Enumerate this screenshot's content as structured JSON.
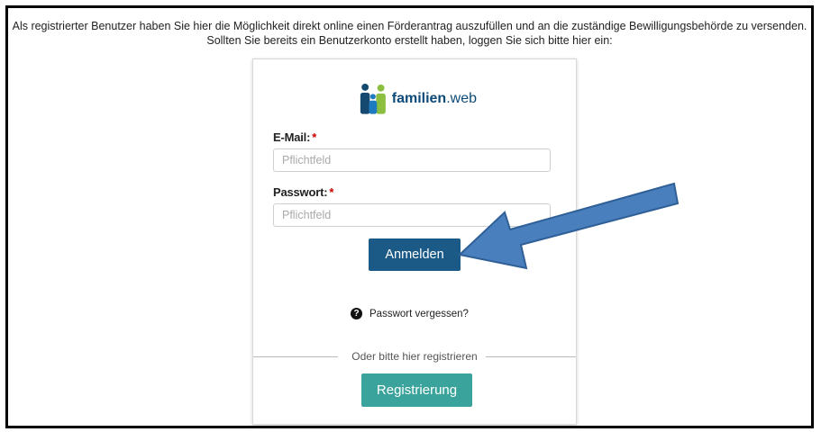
{
  "intro": {
    "line1": "Als registrierter Benutzer haben Sie hier die Möglichkeit direkt online einen Förderantrag auszufüllen und an die zuständige Bewilligungsbehörde zu versenden.",
    "line2": "Sollten Sie bereits ein Benutzerkonto erstellt haben, loggen Sie sich bitte hier ein:"
  },
  "logo": {
    "brand_bold": "familien",
    "brand_suffix": ".web"
  },
  "form": {
    "email_label": "E-Mail:",
    "email_placeholder": "Pflichtfeld",
    "password_label": "Passwort:",
    "password_placeholder": "Pflichtfeld",
    "required_marker": "*",
    "login_button": "Anmelden",
    "forgot_password": "Passwort vergessen?",
    "divider_text": "Oder bitte hier registrieren",
    "register_button": "Registrierung"
  },
  "colors": {
    "login_button": "#1b5a86",
    "register_button": "#3aa39b",
    "annotation_arrow": "#4a7fbd"
  },
  "icons": {
    "help": "question-circle-icon",
    "annotation": "arrow-annotation"
  }
}
